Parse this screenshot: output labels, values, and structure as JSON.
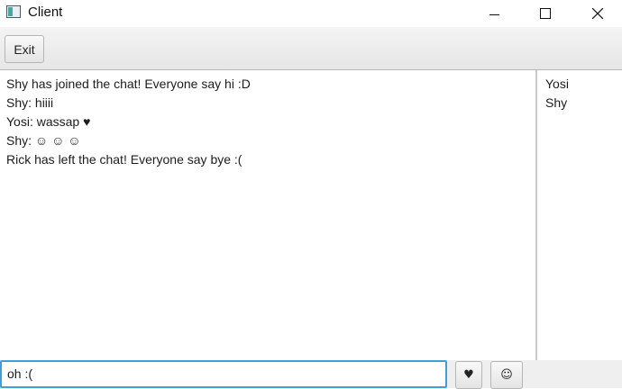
{
  "window": {
    "title": "Client"
  },
  "toolbar": {
    "exit_label": "Exit"
  },
  "chat": {
    "messages": [
      "Shy has joined the chat! Everyone say hi :D",
      "Shy: hiiii",
      "Yosi: wassap ♥",
      "Shy: ☺ ☺ ☺",
      "Rick has left the chat! Everyone say bye :("
    ]
  },
  "users": {
    "list": [
      "Yosi",
      "Shy"
    ]
  },
  "input": {
    "value": "oh :("
  },
  "emoji_buttons": {
    "heart": "♥",
    "smile": "☺"
  },
  "colors": {
    "focus_border": "#3fa0d8",
    "toolbar_bg": "#e6e6e6"
  }
}
